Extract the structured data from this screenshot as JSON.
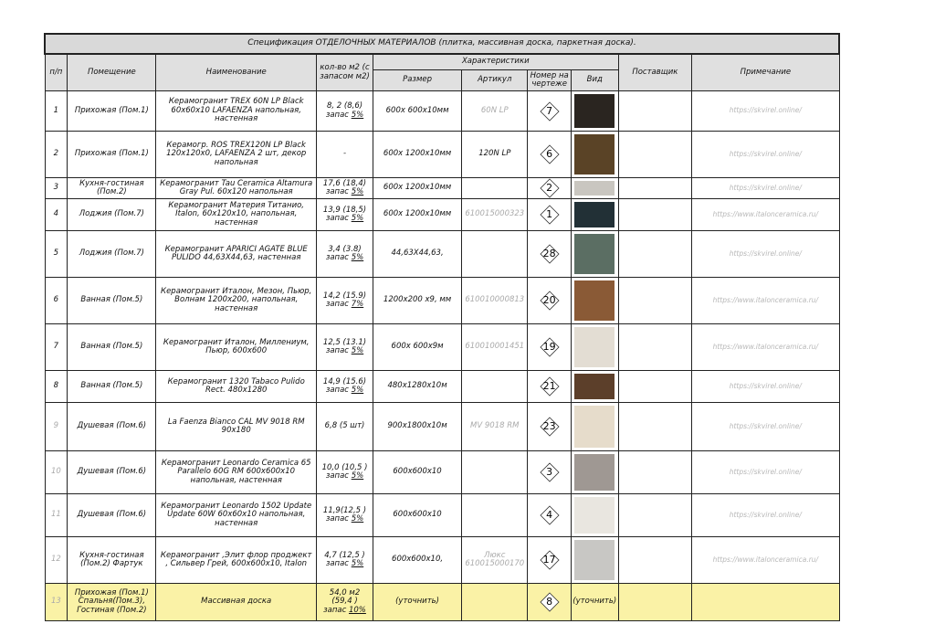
{
  "title": "Спецификация ОТДЕЛОЧНЫХ МАТЕРИАЛОВ (плитка, массивная доска, паркетная доска).",
  "headers": {
    "num": "п/п",
    "room": "Помещение",
    "name": "Наименование",
    "qty": "кол-во м2 (с запасом м2)",
    "characteristics": "Характеристики",
    "size": "Размер",
    "article": "Артикул",
    "drawing_no": "Номер на чертеже",
    "view": "Вид",
    "supplier": "Поставщик",
    "note": "Примечание"
  },
  "rows": [
    {
      "num": "1",
      "room": "Прихожая (Пом.1)",
      "name": "Керамогранит TREX 60N LP Black 60x60x10 LAFAENZA напольная, настенная",
      "qty": "8, 2 (8,6)",
      "reserve_label": "запас",
      "reserve_pct": "5%",
      "size": "600x 600x10мм",
      "article": "60N LP",
      "article_gray": true,
      "mark": "7",
      "swatch": "#2a2520",
      "note": "https://skvirel.online/"
    },
    {
      "num": "2",
      "room": "Прихожая (Пом.1)",
      "name": "Керамогр. ROS TREX120N LP Black 120x120x0, LAFAENZA 2 шт, декор напольная",
      "qty": "-",
      "reserve_label": "",
      "reserve_pct": "",
      "size": "600x 1200x10мм",
      "article": "120N LP",
      "article_gray": false,
      "mark": "6",
      "swatch": "#5a4326",
      "note": "https://skvirel.online/"
    },
    {
      "num": "3",
      "room": "Кухня-гостиная (Пом.2)",
      "name": "Керамогранит Tau Ceramica Altamura Gray Pul. 60x120 напольная",
      "qty": "17,6 (18,4)",
      "reserve_label": "запас",
      "reserve_pct": "5%",
      "size": "600x 1200x10мм",
      "article": "",
      "article_gray": false,
      "mark": "2",
      "swatch": "#c9c6c0",
      "note": "https://skvirel.online/"
    },
    {
      "num": "4",
      "room": "Лоджия (Пом.7)",
      "name": "Керамогранит Материя Титанио, Italon, 60x120x10, напольная, настенная",
      "qty": "13,9 (18,5)",
      "reserve_label": "запас",
      "reserve_pct": "5%",
      "size": "600x 1200x10мм",
      "article": "610015000323",
      "article_gray": true,
      "mark": "1",
      "swatch": "#223036",
      "note": "https://www.italonceramica.ru/"
    },
    {
      "num": "5",
      "room": "Лоджия (Пом.7)",
      "name": "Керамогранит APARICI AGATE BLUE PULIDO 44,63X44,63, настенная",
      "qty": "3,4 (3.8)",
      "reserve_label": "запас",
      "reserve_pct": "5%",
      "size": "44,63X44,63,",
      "article": "",
      "article_gray": false,
      "mark": "28",
      "swatch": "#5b6e63",
      "note": "https://skvirel.online/"
    },
    {
      "num": "6",
      "room": "Ванная (Пом.5)",
      "name": "Керамогранит Италон, Мезон, Пьюр, Волнам 1200x200, напольная, настенная",
      "qty": "14,2 (15.9)",
      "reserve_label": "запас",
      "reserve_pct": "7%",
      "size": "1200x200 x9, мм",
      "article": "610010000813",
      "article_gray": true,
      "mark": "20",
      "swatch": "#8a5a36",
      "note": "https://www.italonceramica.ru/"
    },
    {
      "num": "7",
      "room": "Ванная (Пом.5)",
      "name": "Керамогранит Италон, Миллениум, Пьюр, 600x600",
      "qty": "12,5 (13.1)",
      "reserve_label": "запас",
      "reserve_pct": "5%",
      "size": "600x 600x9м",
      "article": "610010001451",
      "article_gray": true,
      "mark": "19",
      "swatch": "#e3ddd3",
      "note": "https://www.italonceramica.ru/"
    },
    {
      "num": "8",
      "room": "Ванная (Пом.5)",
      "name": "Керамогранит 1320 Tabaco Pulido Rect. 480x1280",
      "qty": "14,9 (15.6)",
      "reserve_label": "запас",
      "reserve_pct": "5%",
      "size": "480x1280x10м",
      "article": "",
      "article_gray": false,
      "mark": "21",
      "swatch": "#5c3f2a",
      "note": "https://skvirel.online/"
    },
    {
      "num": "9",
      "room": "Душевая (Пом.6)",
      "name": "La Faenza Bianco CAL MV 9018 RM 90x180",
      "qty": "6,8 (5 шт)",
      "reserve_label": "",
      "reserve_pct": "",
      "size": "900x1800x10м",
      "article": "MV 9018 RM",
      "article_gray": true,
      "mark": "23",
      "swatch": "#e6dccb",
      "note": "https://skvirel.online/"
    },
    {
      "num": "10",
      "room": "Душевая (Пом.6)",
      "name": "Керамогранит Leonardo Ceramica 65 Parallelo 60G RM 600x600x10 напольная, настенная",
      "qty": "10,0 (10,5 )",
      "reserve_label": "запас",
      "reserve_pct": "5%",
      "size": "600x600x10",
      "article": "",
      "article_gray": false,
      "mark": "3",
      "swatch": "#9f9893",
      "note": "https://skvirel.online/"
    },
    {
      "num": "11",
      "room": "Душевая (Пом.6)",
      "name": "Керамогранит Leonardo 1502 Update Update 60W 60x60x10 напольная, настенная",
      "qty": "11,9(12,5 )",
      "reserve_label": "запас",
      "reserve_pct": "5%",
      "size": "600x600x10",
      "article": "",
      "article_gray": false,
      "mark": "4",
      "swatch": "#e9e6e0",
      "note": "https://skvirel.online/"
    },
    {
      "num": "12",
      "room": "Кухня-гостиная (Пом.2) Фартук",
      "name": "Керамогранит ,Элит флор проджект , Сильвер Грей, 600x600x10, Italon",
      "qty": "4,7 (12,5 )",
      "reserve_label": "запас",
      "reserve_pct": "5%",
      "size": "600x600x10,",
      "article": "Люкс 610015000170",
      "article_gray": true,
      "mark": "17",
      "swatch": "#c8c7c4",
      "note": "https://www.italonceramica.ru/"
    },
    {
      "num": "13",
      "room": "Прихожая (Пом.1) Спальня(Пом.3), Гостиная (Пом.2)",
      "name": "Массивная доска",
      "qty": "54,0 м2 (59,4 )",
      "reserve_label": "запас",
      "reserve_pct": "10%",
      "size": "(уточнить)",
      "article": "",
      "article_gray": false,
      "mark": "8",
      "swatch": "",
      "view_text": "(уточнить)",
      "note": ""
    }
  ]
}
